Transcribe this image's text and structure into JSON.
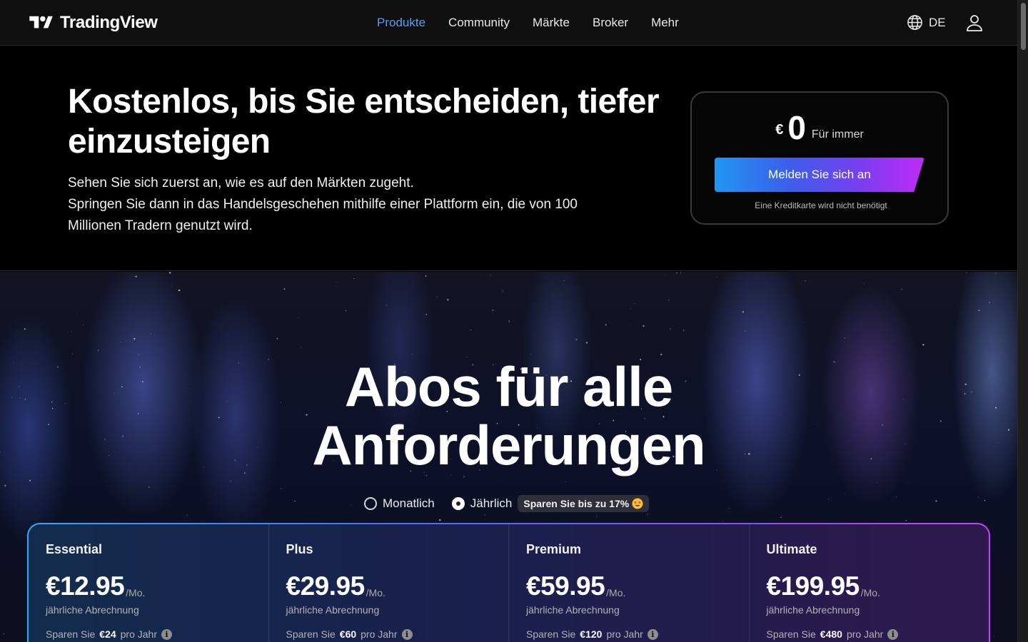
{
  "header": {
    "logo_text": "TradingView",
    "nav": [
      {
        "label": "Produkte",
        "active": true
      },
      {
        "label": "Community",
        "active": false
      },
      {
        "label": "Märkte",
        "active": false
      },
      {
        "label": "Broker",
        "active": false
      },
      {
        "label": "Mehr",
        "active": false
      }
    ],
    "language": "DE",
    "icons": {
      "language": "globe-icon",
      "account": "user-icon"
    }
  },
  "hero": {
    "title": "Kostenlos, bis Sie entscheiden, tiefer einzusteigen",
    "subtitle_line1": "Sehen Sie sich zuerst an, wie es auf den Märkten zugeht.",
    "subtitle_line2": "Springen Sie dann in das Handelsgeschehen mithilfe einer Plattform ein, die von 100 Millionen Tradern genutzt wird.",
    "price_card": {
      "currency": "€",
      "price": "0",
      "period": "Für immer",
      "cta": "Melden Sie sich an",
      "note": "Eine Kreditkarte wird nicht benötigt"
    }
  },
  "plans_section": {
    "title_line1": "Abos für alle",
    "title_line2": "Anforderungen",
    "billing": {
      "monthly": "Monatlich",
      "yearly": "Jährlich",
      "selected": "yearly",
      "badge": "Sparen Sie bis zu 17%"
    },
    "plans": [
      {
        "name": "Essential",
        "price": "€12.95",
        "per": "/Mo.",
        "billing": "jährliche Abrechnung",
        "save_prefix": "Sparen Sie",
        "save_amount": "€24",
        "save_suffix": "pro Jahr"
      },
      {
        "name": "Plus",
        "price": "€29.95",
        "per": "/Mo.",
        "billing": "jährliche Abrechnung",
        "save_prefix": "Sparen Sie",
        "save_amount": "€60",
        "save_suffix": "pro Jahr"
      },
      {
        "name": "Premium",
        "price": "€59.95",
        "per": "/Mo.",
        "billing": "jährliche Abrechnung",
        "save_prefix": "Sparen Sie",
        "save_amount": "€120",
        "save_suffix": "pro Jahr"
      },
      {
        "name": "Ultimate",
        "price": "€199.95",
        "per": "/Mo.",
        "billing": "jährliche Abrechnung",
        "save_prefix": "Sparen Sie",
        "save_amount": "€480",
        "save_suffix": "pro Jahr"
      }
    ]
  },
  "colors": {
    "nav_active": "#5b9cf6",
    "cta_gradient_start": "#2196f3",
    "cta_gradient_end": "#c02bf5"
  }
}
